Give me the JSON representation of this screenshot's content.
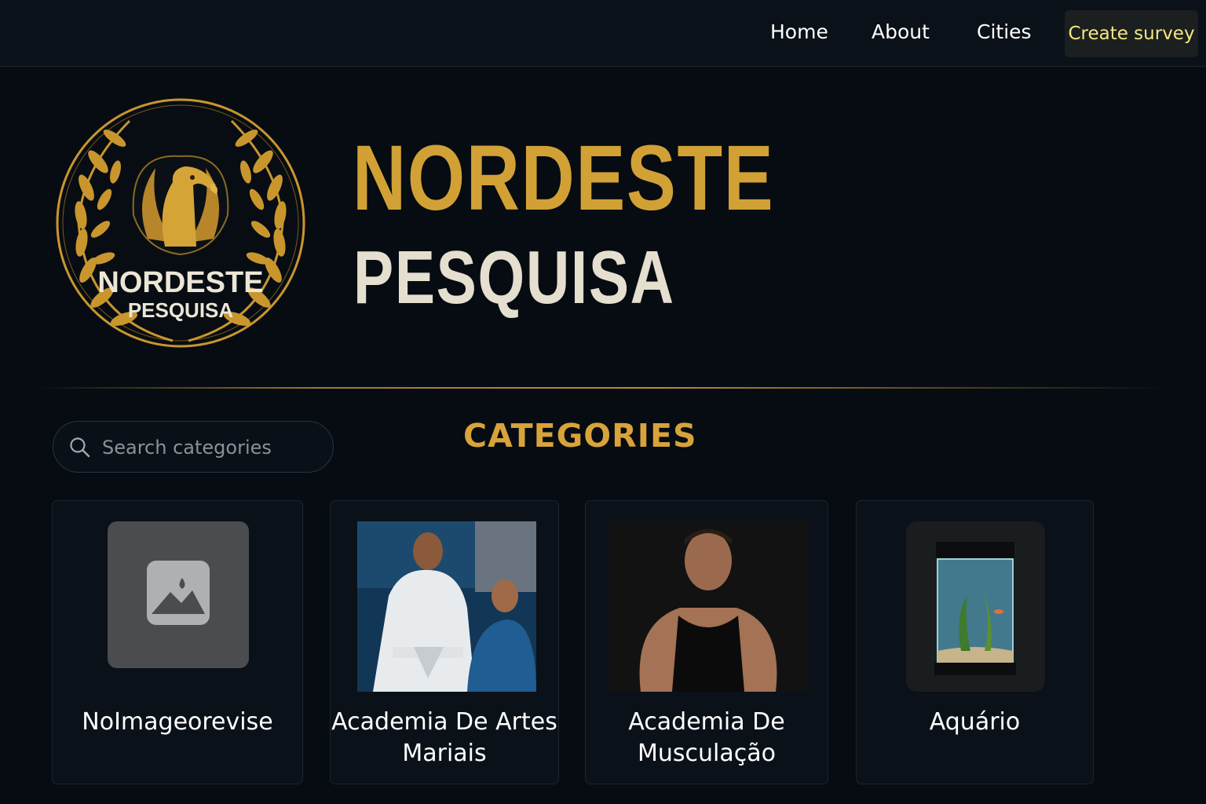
{
  "nav": {
    "home": "Home",
    "about": "About",
    "cities": "Cities",
    "cta": "Create survey"
  },
  "logo": {
    "line1": "NORDESTE",
    "line2": "PESQUISA"
  },
  "hero": {
    "title": "NORDESTE",
    "subtitle": "PESQUISA"
  },
  "search": {
    "placeholder": "Search categories"
  },
  "categories_title": "CATEGORIES",
  "categories": [
    {
      "name": "NoImageorevise",
      "image": "placeholder-image-icon"
    },
    {
      "name": "Academia De Artes Mariais",
      "image": "martial-arts-photo"
    },
    {
      "name": "Academia De Musculação",
      "image": "bodybuilder-photo"
    },
    {
      "name": "Aquário",
      "image": "aquarium-photo"
    }
  ],
  "colors": {
    "background": "#070c12",
    "gold": "#d2a136",
    "cta_text": "#f3e783",
    "card": "#0b1119"
  }
}
